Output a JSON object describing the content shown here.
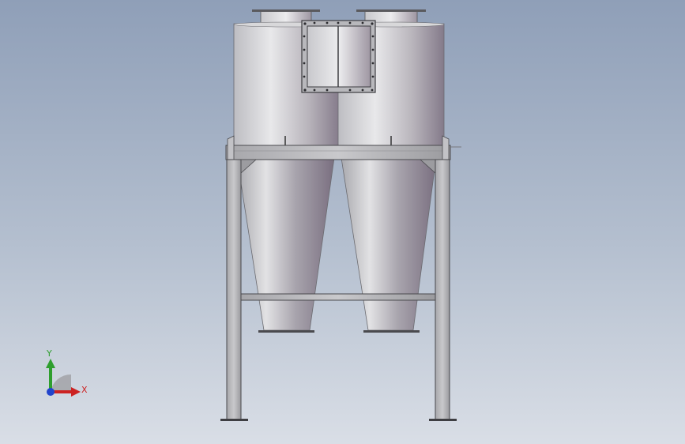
{
  "viewport": {
    "background_top": "#8f9fb8",
    "background_bottom": "#d9dee6"
  },
  "model": {
    "icon": "twin-cyclone-separator-model",
    "frame_color": "#b4b4b8",
    "body_highlight": "#e6e6e8",
    "body_shadow": "#7e7284"
  },
  "triad": {
    "y_label": "Y",
    "x_label": "X",
    "y_color": "#2e9e2e",
    "x_color": "#cc2222",
    "z_color": "#2244cc"
  }
}
